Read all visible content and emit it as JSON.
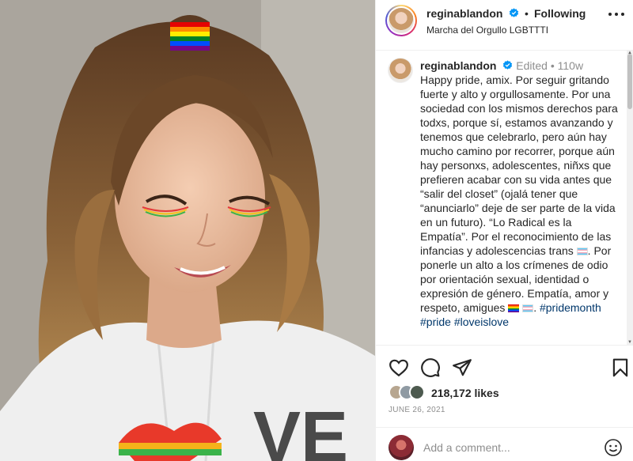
{
  "post": {
    "username": "reginablandon",
    "follow_label": "Following",
    "separator": "•",
    "location": "Marcha del Orgullo LGBTTTI"
  },
  "caption": {
    "username": "reginablandon",
    "edited": "Edited",
    "meta_separator": "•",
    "age": "110w",
    "text_1": "Happy pride, amix. Por seguir gritando fuerte y alto y orgullosamente. Por una sociedad con los mismos derechos para todxs, porque sí, estamos avanzando y tenemos que celebrarlo, pero aún hay mucho camino por recorrer, porque aún hay personxs, adolescentes, niñxs que prefieren acabar con su vida antes que “salir del closet” (ojalá tener que “anunciarlo” deje de ser parte de la vida en un futuro). “Lo Radical es la Empatía”. Por el reconocimiento de las infancias y adolescencias trans ",
    "text_2": ". Por ponerle un alto a los crímenes de odio por orientación sexual, identidad o expresión de género. Empatía, amor y respeto, amigues ",
    "hashtag_1": "#pridemonth",
    "hashtag_2": "#pride",
    "hashtag_3": "#loveislove"
  },
  "engagement": {
    "likes": "218,172 likes",
    "date": "JUNE 26, 2021"
  },
  "comment_box": {
    "placeholder": "Add a comment..."
  },
  "icons": {
    "like": "heart-icon",
    "comment": "comment-icon",
    "share": "send-icon",
    "save": "bookmark-icon",
    "options": "more-options-icon",
    "emoji": "emoji-icon",
    "verified": "verified-badge-icon"
  },
  "colors": {
    "text": "#262626",
    "muted": "#8e8e8e",
    "hashtag": "#00376b",
    "verified": "#0095f6",
    "border": "#efefef"
  }
}
